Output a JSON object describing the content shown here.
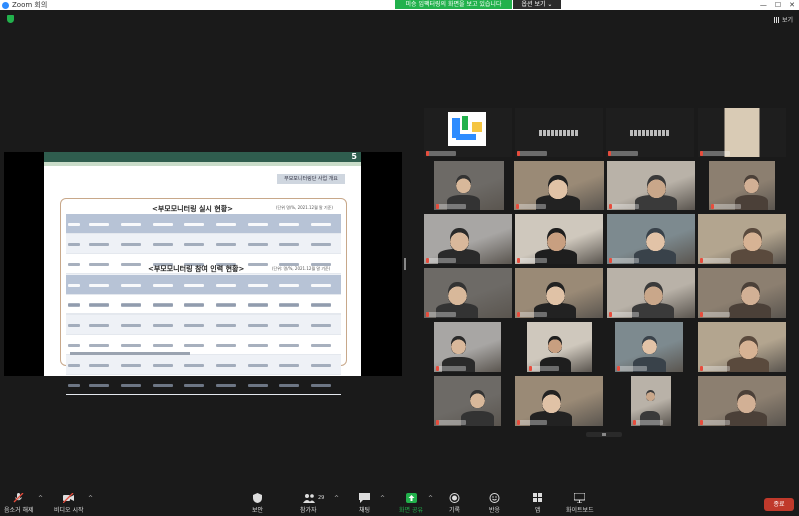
{
  "window": {
    "title": "Zoom 회의",
    "minimize": "—",
    "maximize": "☐",
    "close": "✕"
  },
  "banner": {
    "sharing_text": "미승 임팩터링의 화면을 보고 있습니다",
    "view_options": "옵션 보기 ⌄"
  },
  "top_right": {
    "view_label": "보기"
  },
  "slide": {
    "page_number": "5",
    "subtitle": "부모모니터링단 사업 개요",
    "section1_title": "<부모모니터링 실시 현황>",
    "section1_note": "(단위 명/%, 2021.12월 말 기준)",
    "section2_title": "<부모모니터링 참여 인력 현황>",
    "section2_note": "(단위: 명/%, 2021.12월 말 기준)"
  },
  "participants_count": "29",
  "toolbar": {
    "mute": "음소거 해제",
    "video": "비디오 시작",
    "security": "보안",
    "participants": "참가자",
    "chat": "채팅",
    "share": "화면 공유",
    "record": "기록",
    "reactions": "반응",
    "apps": "앱",
    "whiteboard": "화이트보드",
    "end": "종료"
  },
  "colors": {
    "accent_green": "#22b14c",
    "end_red": "#c0392b",
    "slide_header": "#2f5d4e"
  }
}
